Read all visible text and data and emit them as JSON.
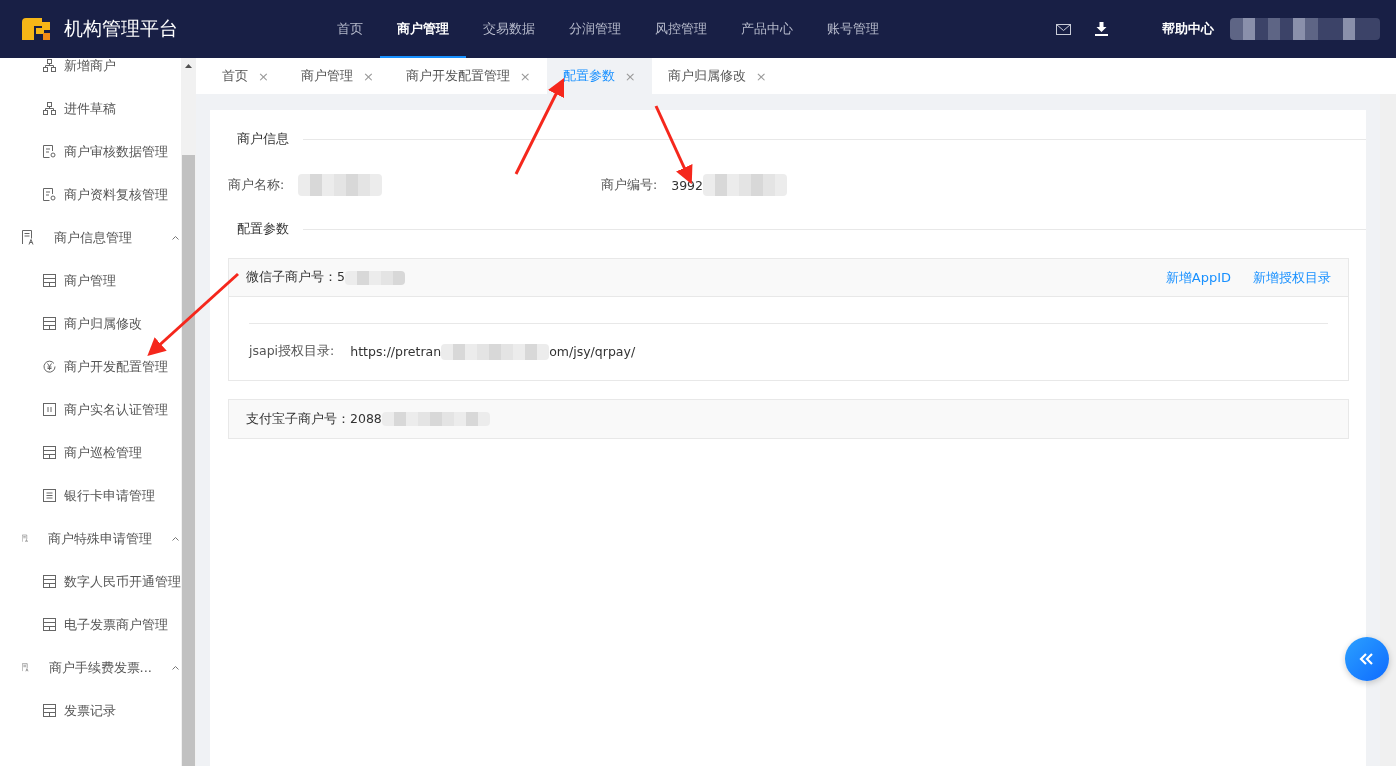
{
  "header": {
    "title": "机构管理平台",
    "nav": [
      {
        "label": "首页",
        "selected": false
      },
      {
        "label": "商户管理",
        "selected": true
      },
      {
        "label": "交易数据",
        "selected": false
      },
      {
        "label": "分润管理",
        "selected": false
      },
      {
        "label": "风控管理",
        "selected": false
      },
      {
        "label": "产品中心",
        "selected": false
      },
      {
        "label": "账号管理",
        "selected": false
      }
    ],
    "help": "帮助中心",
    "user_masked": true
  },
  "sidebar": {
    "items": [
      {
        "kind": "link",
        "label": "新增商户"
      },
      {
        "kind": "link",
        "label": "进件草稿"
      },
      {
        "kind": "link",
        "label": "商户审核数据管理"
      },
      {
        "kind": "link",
        "label": "商户资料复核管理"
      },
      {
        "kind": "group",
        "label": "商户信息管理",
        "expanded": true,
        "children": [
          {
            "kind": "link",
            "label": "商户管理"
          },
          {
            "kind": "link",
            "label": "商户归属修改"
          },
          {
            "kind": "link",
            "label": "商户开发配置管理"
          },
          {
            "kind": "link",
            "label": "商户实名认证管理"
          },
          {
            "kind": "link",
            "label": "商户巡检管理"
          },
          {
            "kind": "link",
            "label": "银行卡申请管理"
          }
        ]
      },
      {
        "kind": "group",
        "label": "商户特殊申请管理",
        "expanded": true,
        "children": [
          {
            "kind": "link",
            "label": "数字人民币开通管理"
          },
          {
            "kind": "link",
            "label": "电子发票商户管理"
          }
        ]
      },
      {
        "kind": "group",
        "label": "商户手续费发票...",
        "expanded": true,
        "children": [
          {
            "kind": "link",
            "label": "发票记录"
          }
        ]
      }
    ]
  },
  "tabs": [
    {
      "label": "首页",
      "close": "×",
      "selected": false
    },
    {
      "label": "商户管理",
      "close": "×",
      "selected": false
    },
    {
      "label": "商户开发配置管理",
      "close": "×",
      "selected": false
    },
    {
      "label": "配置参数",
      "close": "×",
      "selected": true
    },
    {
      "label": "商户归属修改",
      "close": "×",
      "selected": false
    }
  ],
  "merchant_info": {
    "title": "商户信息",
    "fields": [
      {
        "label": "商户名称:",
        "masked": true
      },
      {
        "label": "商户编号:",
        "value": "3992",
        "masked": true
      }
    ]
  },
  "config": {
    "title": "配置参数",
    "panels": [
      {
        "title": "微信子商户号：5",
        "masked": true,
        "actions": [
          "新增AppID",
          "新增授权目录"
        ],
        "rows": [
          {
            "label": "jsapi授权目录:",
            "value_start": "https://pretran",
            "value_end": "om/jsy/qrpay/"
          }
        ]
      },
      {
        "title": "支付宝子商户号：2088",
        "masked": true
      }
    ]
  }
}
